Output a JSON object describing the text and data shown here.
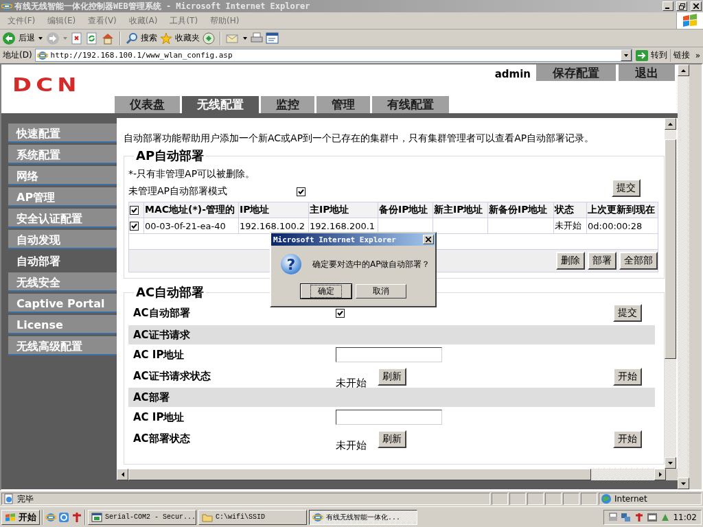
{
  "window": {
    "title": "有线无线智能一体化控制器WEB管理系统 - Microsoft Internet Explorer"
  },
  "menu": [
    "文件(F)",
    "编辑(E)",
    "查看(V)",
    "收藏(A)",
    "工具(T)",
    "帮助(H)"
  ],
  "toolbar": {
    "back": "后退",
    "search": "搜索",
    "favorites": "收藏夹"
  },
  "address": {
    "label": "地址(D)",
    "url": "http://192.168.100.1/www_wlan_config.asp",
    "go": "转到",
    "links": "链接",
    "links_more": "»"
  },
  "page": {
    "logo": "DCN",
    "user": "admin",
    "header_buttons": [
      "保存配置",
      "退出"
    ],
    "tabs": [
      {
        "label": "仪表盘",
        "selected": false
      },
      {
        "label": "无线配置",
        "selected": true
      },
      {
        "label": "监控",
        "selected": false
      },
      {
        "label": "管理",
        "selected": false
      },
      {
        "label": "有线配置",
        "selected": false
      }
    ],
    "sidebar": [
      {
        "label": "快速配置",
        "selected": false
      },
      {
        "label": "系统配置",
        "selected": false
      },
      {
        "label": "网络",
        "selected": false
      },
      {
        "label": "AP管理",
        "selected": false
      },
      {
        "label": "安全认证配置",
        "selected": false
      },
      {
        "label": "自动发现",
        "selected": false
      },
      {
        "label": "自动部署",
        "selected": true
      },
      {
        "label": "无线安全",
        "selected": false
      },
      {
        "label": "Captive Portal",
        "selected": false
      },
      {
        "label": "License",
        "selected": false
      },
      {
        "label": "无线高级配置",
        "selected": false
      }
    ],
    "intro": "自动部署功能帮助用户添加一个新AC或AP到一个已存在的集群中，只有集群管理者可以查看AP自动部署记录。",
    "ap_section": {
      "title": "AP自动部署",
      "note": "*-只有非管理AP可以被删除。",
      "mode_label": "未管理AP自动部署模式",
      "mode_checked": true,
      "submit": "提交",
      "table": {
        "all_checked": true,
        "columns": [
          "MAC地址(*)-管理的",
          "IP地址",
          "主IP地址",
          "备份IP地址",
          "新主IP地址",
          "新备份IP地址",
          "状态",
          "上次更新到现在"
        ],
        "rows": [
          {
            "checked": true,
            "cells": [
              "00-03-0f-21-ea-40",
              "192.168.100.2",
              "192.168.200.1",
              null,
              null,
              null,
              "未开始",
              "0d:00:00:28"
            ]
          }
        ]
      },
      "buttons": [
        "删除",
        "部署",
        "全部部"
      ]
    },
    "ac_section": {
      "title": "AC自动部署",
      "auto_label": "AC自动部署",
      "auto_checked": true,
      "submit": "提交",
      "groups": [
        {
          "title": "AC证书请求",
          "ip_label": "AC IP地址",
          "status_label": "AC证书请求状态",
          "status": "未开始",
          "refresh": "刷新",
          "start": "开始"
        },
        {
          "title": "AC部署",
          "ip_label": "AC IP地址",
          "status_label": "AC部署状态",
          "status": "未开始",
          "refresh": "刷新",
          "start": "开始"
        }
      ]
    }
  },
  "dialog": {
    "title": "Microsoft Internet Explorer",
    "icon": "?",
    "message": "确定要对选中的AP做自动部署？",
    "buttons": [
      {
        "label": "确定",
        "focused": true
      },
      {
        "label": "取消",
        "focused": false
      }
    ]
  },
  "status_bar": {
    "text": "完毕",
    "zone": "Internet"
  },
  "taskbar": {
    "start": "开始",
    "tasks": [
      {
        "label": "Serial-COM2 - Secur...",
        "selected": false
      },
      {
        "label": "C:\\wifi\\SSID",
        "selected": false
      },
      {
        "label": "有线无线智能一体化...",
        "selected": true
      }
    ],
    "clock": "11:02"
  }
}
